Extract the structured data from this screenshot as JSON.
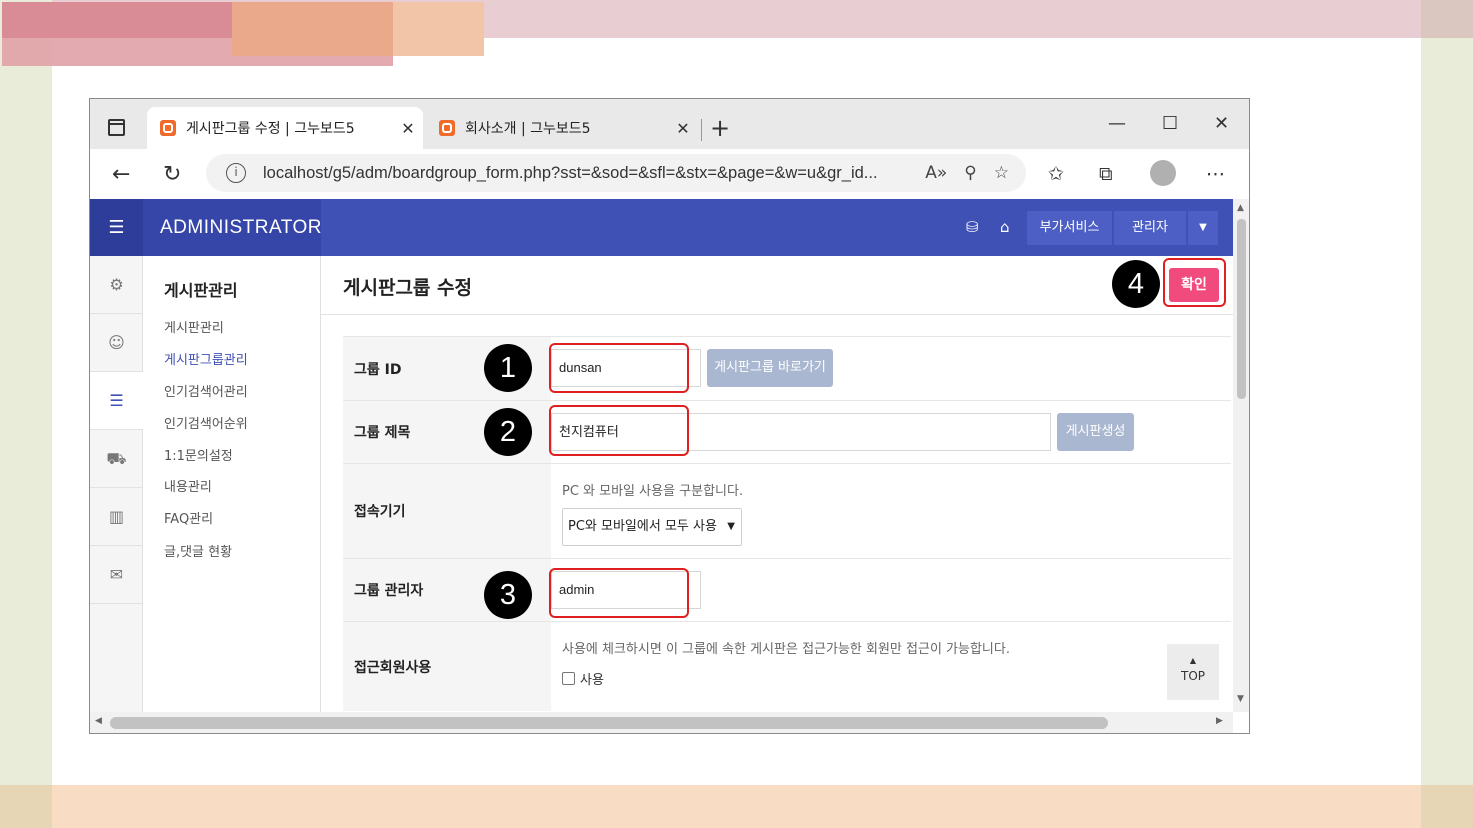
{
  "browser": {
    "tabs": [
      {
        "title": "게시판그룹 수정 | 그누보드5",
        "active": true
      },
      {
        "title": "회사소개 | 그누보드5",
        "active": false
      }
    ],
    "url": "localhost/g5/adm/boardgroup_form.php?sst=&sod=&sfl=&stx=&page=&w=u&gr_id..."
  },
  "admin": {
    "brand": "ADMINISTRATOR",
    "top_buttons": {
      "addon": "부가서비스",
      "admin": "관리자"
    },
    "submenu": {
      "title": "게시판관리",
      "items": [
        {
          "label": "게시판관리",
          "active": false
        },
        {
          "label": "게시판그룹관리",
          "active": true
        },
        {
          "label": "인기검색어관리",
          "active": false
        },
        {
          "label": "인기검색어순위",
          "active": false
        },
        {
          "label": "1:1문의설정",
          "active": false
        },
        {
          "label": "내용관리",
          "active": false
        },
        {
          "label": "FAQ관리",
          "active": false
        },
        {
          "label": "글,댓글 현황",
          "active": false
        }
      ]
    },
    "page_title": "게시판그룹 수정",
    "confirm_label": "확인",
    "form": {
      "group_id": {
        "label": "그룹 ID",
        "value": "dunsan",
        "button": "게시판그룹 바로가기"
      },
      "group_title": {
        "label": "그룹 제목",
        "value": "천지컴퓨터",
        "button": "게시판생성"
      },
      "device": {
        "label": "접속기기",
        "help": "PC 와 모바일 사용을 구분합니다.",
        "selected": "PC와 모바일에서 모두 사용"
      },
      "group_admin": {
        "label": "그룹 관리자",
        "value": "admin"
      },
      "member_access": {
        "label": "접근회원사용",
        "help": "사용에 체크하시면 이 그룹에 속한 게시판은 접근가능한 회원만 접근이 가능합니다.",
        "checkbox_label": "사용",
        "checked": false
      }
    },
    "top_button_label": "TOP"
  },
  "annotations": [
    "1",
    "2",
    "3",
    "4"
  ],
  "colors": {
    "header": "#3f51b5",
    "confirm": "#f14a7d",
    "highlight": "#e02020"
  }
}
